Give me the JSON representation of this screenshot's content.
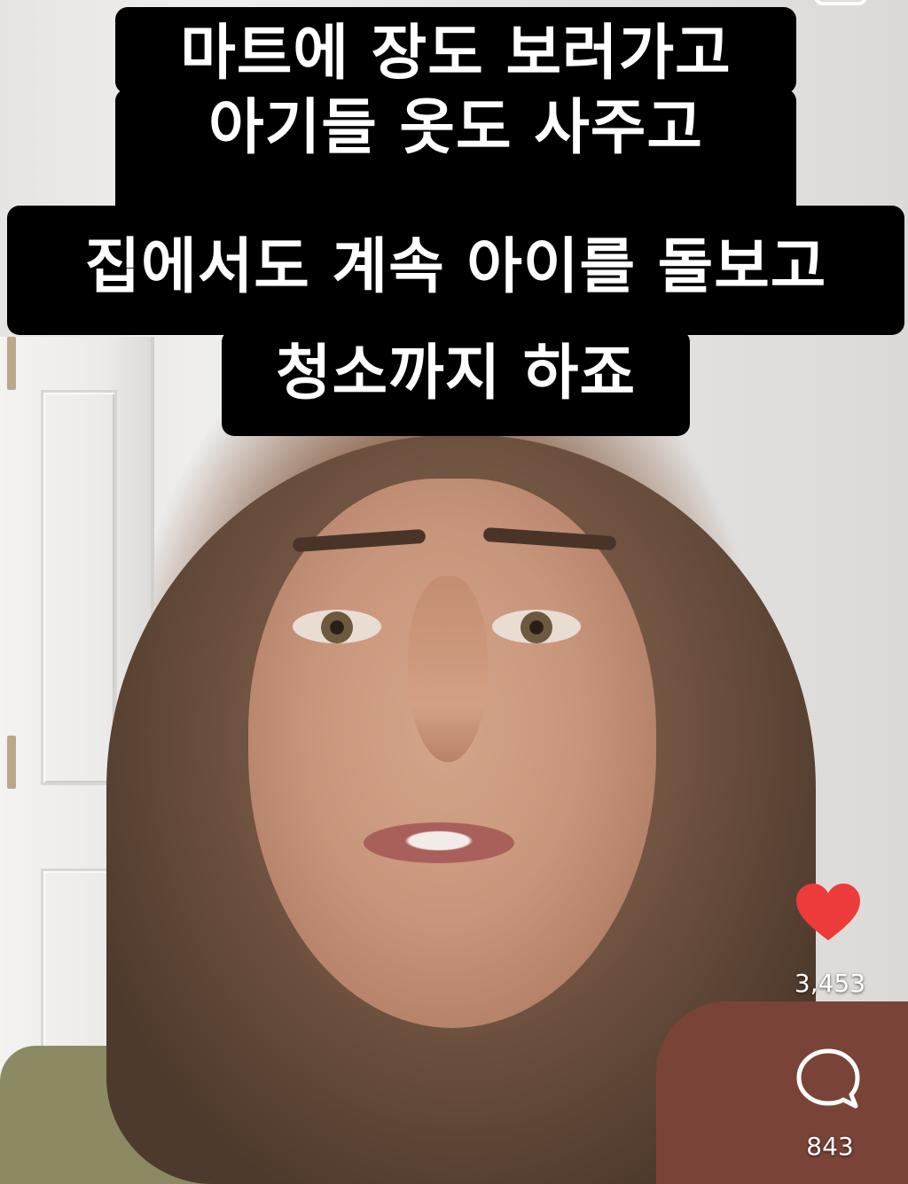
{
  "caption": {
    "lines": [
      "마트에 장도 보러가고",
      "아기들 옷도 사주고",
      "집에서도 계속 아이를 돌보고",
      "청소까지 하죠"
    ]
  },
  "actions": {
    "likes_count": "3,453",
    "comments_count": "843",
    "like_icon": "heart-icon",
    "comment_icon": "comment-bubble-icon",
    "like_color": "#ed3b3b"
  }
}
